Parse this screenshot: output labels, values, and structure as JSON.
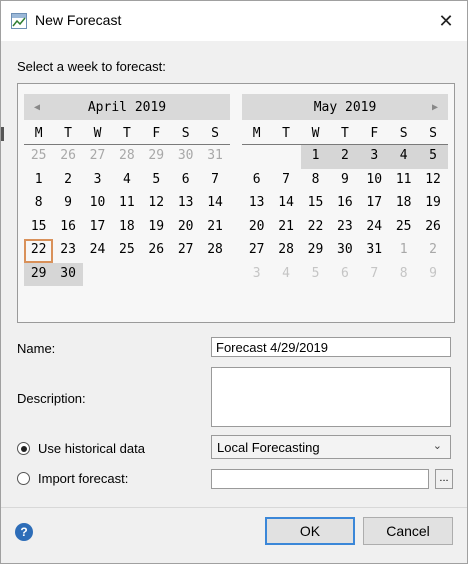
{
  "window": {
    "title": "New Forecast",
    "close_glyph": "✕"
  },
  "calendar": {
    "section_label": "Select a week to forecast:",
    "days_of_week": [
      "M",
      "T",
      "W",
      "T",
      "F",
      "S",
      "S"
    ],
    "nav_prev_glyph": "◀",
    "nav_next_glyph": "▶",
    "months": [
      {
        "title": "April 2019",
        "weeks": [
          [
            {
              "d": "25",
              "s": "other"
            },
            {
              "d": "26",
              "s": "other"
            },
            {
              "d": "27",
              "s": "other"
            },
            {
              "d": "28",
              "s": "other"
            },
            {
              "d": "29",
              "s": "other"
            },
            {
              "d": "30",
              "s": "other"
            },
            {
              "d": "31",
              "s": "other"
            }
          ],
          [
            {
              "d": "1"
            },
            {
              "d": "2"
            },
            {
              "d": "3"
            },
            {
              "d": "4"
            },
            {
              "d": "5"
            },
            {
              "d": "6"
            },
            {
              "d": "7"
            }
          ],
          [
            {
              "d": "8"
            },
            {
              "d": "9"
            },
            {
              "d": "10"
            },
            {
              "d": "11"
            },
            {
              "d": "12"
            },
            {
              "d": "13"
            },
            {
              "d": "14"
            }
          ],
          [
            {
              "d": "15"
            },
            {
              "d": "16"
            },
            {
              "d": "17"
            },
            {
              "d": "18"
            },
            {
              "d": "19"
            },
            {
              "d": "20"
            },
            {
              "d": "21"
            }
          ],
          [
            {
              "d": "22",
              "s": "today"
            },
            {
              "d": "23"
            },
            {
              "d": "24"
            },
            {
              "d": "25"
            },
            {
              "d": "26"
            },
            {
              "d": "27"
            },
            {
              "d": "28"
            }
          ],
          [
            {
              "d": "29",
              "s": "selected"
            },
            {
              "d": "30",
              "s": "selected"
            },
            {
              "d": ""
            },
            {
              "d": ""
            },
            {
              "d": ""
            },
            {
              "d": ""
            },
            {
              "d": ""
            }
          ]
        ]
      },
      {
        "title": "May 2019",
        "weeks": [
          [
            {
              "d": ""
            },
            {
              "d": ""
            },
            {
              "d": "1",
              "s": "selected"
            },
            {
              "d": "2",
              "s": "selected"
            },
            {
              "d": "3",
              "s": "selected"
            },
            {
              "d": "4",
              "s": "selected"
            },
            {
              "d": "5",
              "s": "selected"
            }
          ],
          [
            {
              "d": "6"
            },
            {
              "d": "7"
            },
            {
              "d": "8"
            },
            {
              "d": "9"
            },
            {
              "d": "10"
            },
            {
              "d": "11"
            },
            {
              "d": "12"
            }
          ],
          [
            {
              "d": "13"
            },
            {
              "d": "14"
            },
            {
              "d": "15"
            },
            {
              "d": "16"
            },
            {
              "d": "17"
            },
            {
              "d": "18"
            },
            {
              "d": "19"
            }
          ],
          [
            {
              "d": "20"
            },
            {
              "d": "21"
            },
            {
              "d": "22"
            },
            {
              "d": "23"
            },
            {
              "d": "24"
            },
            {
              "d": "25"
            },
            {
              "d": "26"
            }
          ],
          [
            {
              "d": "27"
            },
            {
              "d": "28"
            },
            {
              "d": "29"
            },
            {
              "d": "30"
            },
            {
              "d": "31"
            },
            {
              "d": "1",
              "s": "other"
            },
            {
              "d": "2",
              "s": "other"
            }
          ],
          [
            {
              "d": "3",
              "s": "other-light"
            },
            {
              "d": "4",
              "s": "other-light"
            },
            {
              "d": "5",
              "s": "other-light"
            },
            {
              "d": "6",
              "s": "other-light"
            },
            {
              "d": "7",
              "s": "other-light"
            },
            {
              "d": "8",
              "s": "other-light"
            },
            {
              "d": "9",
              "s": "other-light"
            }
          ]
        ]
      }
    ]
  },
  "form": {
    "name_label": "Name:",
    "name_value": "Forecast 4/29/2019",
    "description_label": "Description:",
    "description_value": "",
    "use_historical_label": "Use historical data",
    "use_historical_checked": true,
    "historical_select_value": "Local Forecasting",
    "import_label": "Import forecast:",
    "import_checked": false,
    "import_value": "",
    "browse_label": "..."
  },
  "footer": {
    "help_glyph": "?",
    "ok_label": "OK",
    "cancel_label": "Cancel"
  },
  "colors": {
    "today_border": "#d9915a",
    "selected_bg": "#d6d6d6",
    "ok_focus": "#3b87d8",
    "help_icon": "#2d6db8"
  }
}
